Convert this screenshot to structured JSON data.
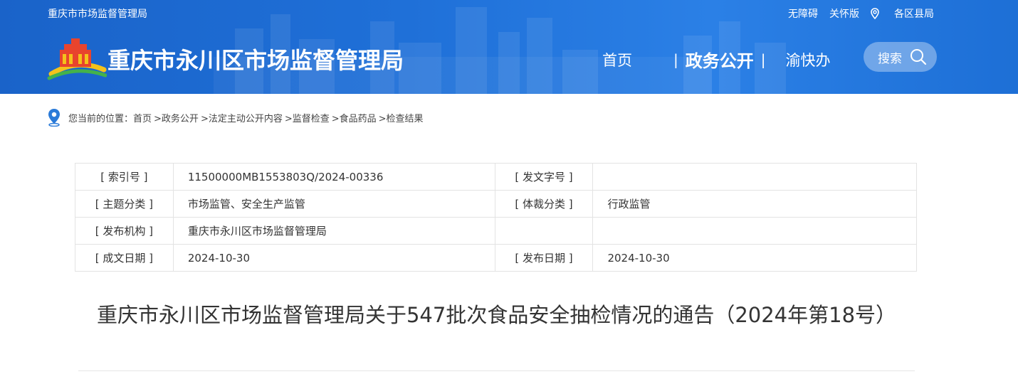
{
  "header": {
    "org_small": "重庆市市场监督管理局",
    "top_links": {
      "accessibility": "无障碍",
      "care": "关怀版",
      "districts": "各区县局"
    },
    "site_title": "重庆市永川区市场监督管理局",
    "nav": [
      {
        "label": "首页"
      },
      {
        "label": "政务公开"
      },
      {
        "label": "渝快办"
      }
    ],
    "nav_sep": "|",
    "search_label": "搜索",
    "colors": {
      "banner": "#1f70d8",
      "text": "#ffffff"
    }
  },
  "breadcrumb": {
    "prefix": "您当前的位置：",
    "items": [
      "首页",
      ">政务公开",
      ">法定主动公开内容",
      ">监督检查",
      ">食品药品",
      ">检查结果"
    ]
  },
  "meta": {
    "rows": [
      {
        "k1": "[ 索引号 ]",
        "v1": "11500000MB1553803Q/2024-00336",
        "k2": "[ 发文字号 ]",
        "v2": ""
      },
      {
        "k1": "[ 主题分类 ]",
        "v1": "市场监管、安全生产监管",
        "k2": "[ 体裁分类 ]",
        "v2": "行政监管"
      },
      {
        "k1": "[ 发布机构 ]",
        "v1": "重庆市永川区市场监督管理局",
        "k2": "",
        "v2": ""
      },
      {
        "k1": "[ 成文日期 ]",
        "v1": "2024-10-30",
        "k2": "[ 发布日期 ]",
        "v2": "2024-10-30"
      }
    ]
  },
  "article": {
    "title": "重庆市永川区市场监督管理局关于547批次食品安全抽检情况的通告（2024年第18号）"
  }
}
